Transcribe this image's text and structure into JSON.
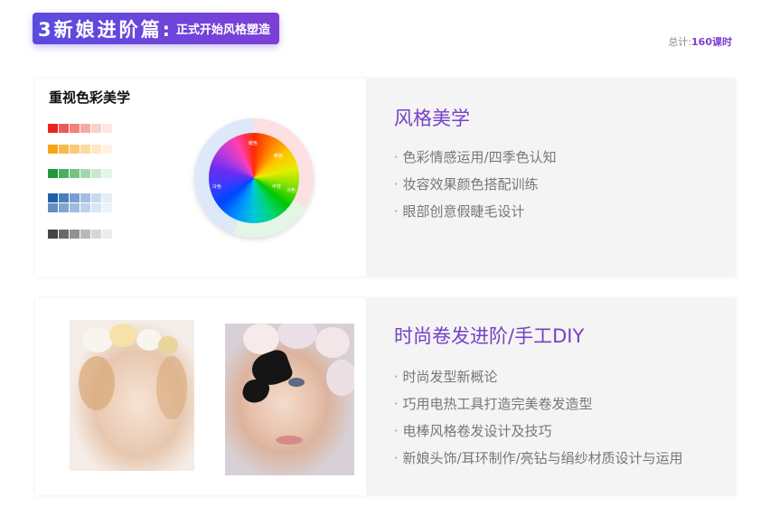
{
  "header": {
    "badge_big": "3新娘进阶篇:",
    "badge_small": "正式开始风格塑造",
    "total_label": "总计:",
    "total_hours": "160课时"
  },
  "section1": {
    "left_title": "重视色彩美学",
    "title": "风格美学",
    "items": [
      "色彩情感运用/四季色认知",
      "妆容效果颜色搭配训练",
      "眼部创意假睫毛设计"
    ],
    "palette_colors": [
      [
        "#e8241f",
        "#ee5a52",
        "#f2837c",
        "#f7aaa5",
        "#fbd0cd",
        "#fde6e4"
      ],
      [
        "#f7a51c",
        "#f8b94c",
        "#fac97a",
        "#fcd9a3",
        "#fde7c6",
        "#fef3e2"
      ],
      [
        "#1f9a3a",
        "#4aaf5f",
        "#76c385",
        "#a2d6ab",
        "#c9e8ce",
        "#e4f4e7"
      ],
      [
        "#1f5fa8",
        "#4a7fbd",
        "#769fd0",
        "#a2bfe1",
        "#c9dbf0",
        "#e4edf8"
      ],
      [
        "#444444",
        "#6a6a6a",
        "#919191",
        "#b8b8b8",
        "#d6d6d6",
        "#ececec"
      ]
    ],
    "wheel_labels": [
      "暖色",
      "暖色",
      "冷色",
      "冷色",
      "中性"
    ]
  },
  "section2": {
    "title": "时尚卷发进阶/手工DIY",
    "items": [
      "时尚发型新概论",
      "巧用电热工具打造完美卷发造型",
      "电棒风格卷发设计及技巧",
      "新娘头饰/耳环制作/亮钻与绢纱材质设计与运用"
    ]
  }
}
